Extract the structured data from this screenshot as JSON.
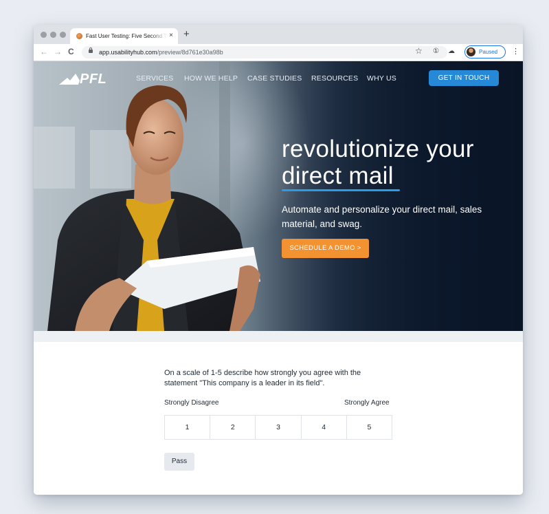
{
  "browser": {
    "tab_title": "Fast User Testing: Five Second Test",
    "tab_close": "×",
    "new_tab": "+",
    "back": "←",
    "forward": "→",
    "reload": "C",
    "url_host": "app.usabilityhub.com",
    "url_path": "/preview/8d761e30a98b",
    "star": "☆",
    "info": "①",
    "cloud": "☁",
    "profile_status": "Paused",
    "menu": "⋮"
  },
  "site": {
    "logo": "PFL",
    "nav": [
      "SERVICES",
      "HOW WE HELP",
      "CASE STUDIES",
      "RESOURCES",
      "WHY US"
    ],
    "cta": "GET IN TOUCH",
    "headline_line1": "revolutionize your",
    "headline_line2": "direct mail",
    "subheadline": "Automate and personalize your direct mail, sales material, and swag.",
    "demo_button": "SCHEDULE A DEMO  >"
  },
  "survey": {
    "question": "On a scale of 1-5 describe how strongly you agree with the statement \"This company is a leader in its field\".",
    "label_low": "Strongly Disagree",
    "label_high": "Strongly Agree",
    "options": [
      "1",
      "2",
      "3",
      "4",
      "5"
    ],
    "pass_button": "Pass"
  },
  "colors": {
    "cta_blue": "#2589d8",
    "demo_orange": "#f39230",
    "underline_blue": "#2e9be6"
  }
}
